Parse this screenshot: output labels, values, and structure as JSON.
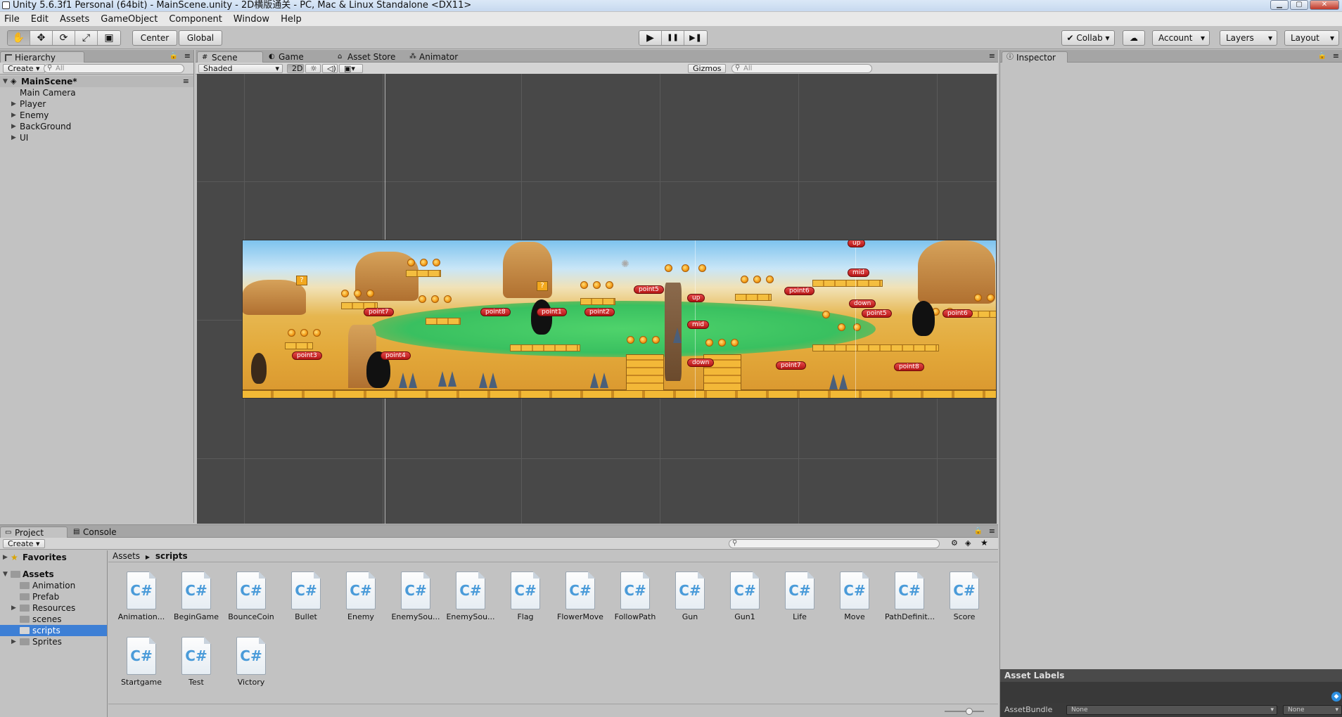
{
  "window": {
    "title": "Unity 5.6.3f1 Personal (64bit) - MainScene.unity - 2D横版通关 - PC, Mac & Linux Standalone <DX11>",
    "min": "▁",
    "max": "▢",
    "close": "✕"
  },
  "menu": [
    "File",
    "Edit",
    "Assets",
    "GameObject",
    "Component",
    "Window",
    "Help"
  ],
  "toolbar": {
    "tools": [
      "✋",
      "✥",
      "⟳",
      "⤢",
      "▣"
    ],
    "pivot": "Center",
    "space": "Global",
    "play": "▶",
    "pause": "❚❚",
    "step": "▶❚",
    "collab": "✔ Collab ▾",
    "cloud": "☁",
    "account": "Account",
    "layers": "Layers",
    "layout": "Layout"
  },
  "hierarchy": {
    "tab": "Hierarchy",
    "create": "Create ▾",
    "search_placeholder": "All",
    "scene": "MainScene*",
    "items": [
      {
        "label": "Main Camera",
        "expand": false
      },
      {
        "label": "Player",
        "expand": true
      },
      {
        "label": "Enemy",
        "expand": true
      },
      {
        "label": "BackGround",
        "expand": true
      },
      {
        "label": "UI",
        "expand": true
      }
    ]
  },
  "scene_tabs": {
    "scene": "Scene",
    "game": "Game",
    "asset_store": "Asset Store",
    "animator": "Animator"
  },
  "scene_bar": {
    "shading": "Shaded",
    "mode2d": "2D",
    "gizmos": "Gizmos ▾",
    "search_placeholder": "All"
  },
  "waypoints": {
    "up1": "up",
    "mid1": "mid",
    "up2": "up",
    "mid2": "mid",
    "down1": "down",
    "down2": "down",
    "p1": "point1",
    "p2": "point2",
    "p3": "point3",
    "p4": "point4",
    "p5a": "point5",
    "p5b": "point5",
    "p6a": "point6",
    "p6b": "point6",
    "p7a": "point7",
    "p7b": "point7",
    "p8a": "point8",
    "p8b": "point8"
  },
  "inspector": {
    "tab": "Inspector",
    "asset_labels": "Asset Labels",
    "asset_bundle": "AssetBundle",
    "bundle_value": "None",
    "variant_value": "None"
  },
  "project": {
    "tab": "Project",
    "console": "Console",
    "create": "Create ▾",
    "favorites": "Favorites",
    "assets": "Assets",
    "folders": [
      {
        "label": "Animation",
        "expand": false
      },
      {
        "label": "Prefab",
        "expand": false
      },
      {
        "label": "Resources",
        "expand": true
      },
      {
        "label": "scenes",
        "expand": false
      },
      {
        "label": "scripts",
        "expand": false,
        "selected": true
      },
      {
        "label": "Sprites",
        "expand": true
      }
    ],
    "breadcrumb_root": "Assets",
    "breadcrumb_current": "scripts",
    "files": [
      "Animation...",
      "BeginGame",
      "BounceCoin",
      "Bullet",
      "Enemy",
      "EnemySou...",
      "EnemySou...",
      "Flag",
      "FlowerMove",
      "FollowPath",
      "Gun",
      "Gun1",
      "Life",
      "Move",
      "PathDefinit...",
      "Score",
      "Startgame",
      "Test",
      "Victory"
    ]
  }
}
